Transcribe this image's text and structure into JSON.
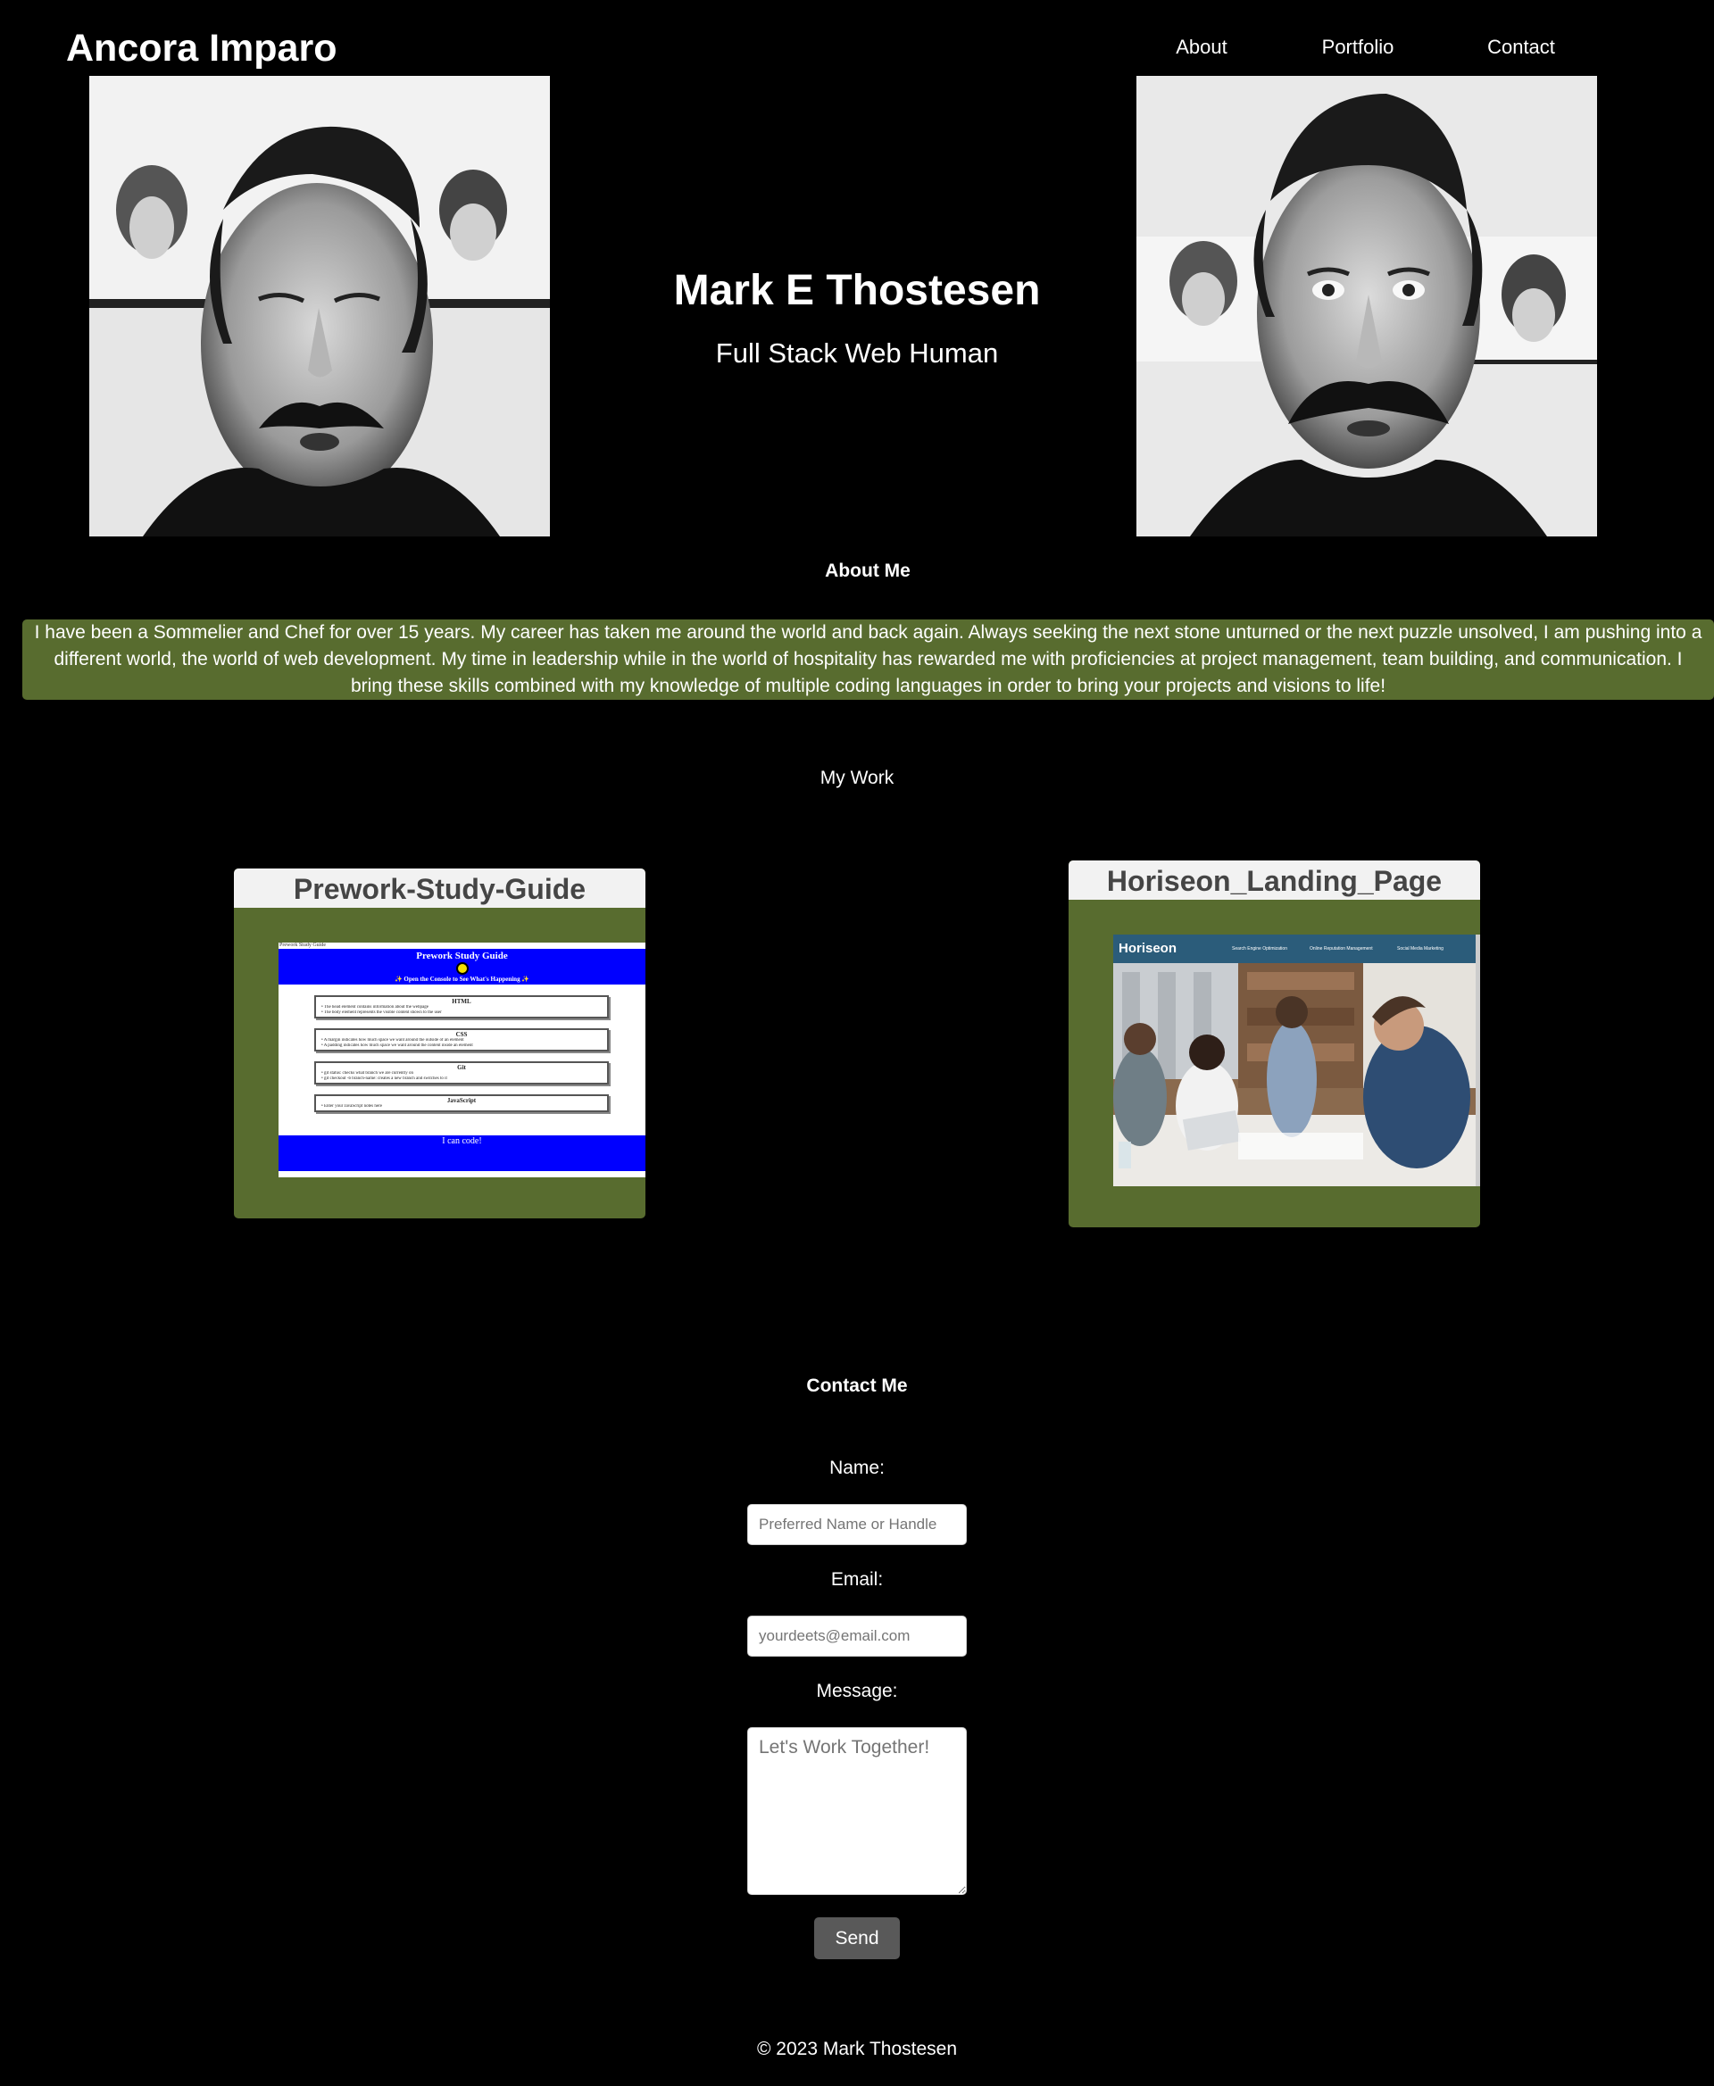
{
  "header": {
    "logo": "Ancora Imparo",
    "nav": [
      "About",
      "Portfolio",
      "Contact"
    ]
  },
  "hero": {
    "name": "Mark E Thostesen",
    "subtitle": "Full Stack Web Human"
  },
  "about": {
    "title": "About Me",
    "text": "I have been a Sommelier and Chef for over 15 years. My career has taken me around the world and back again. Always seeking the next stone unturned or the next puzzle unsolved, I am pushing into a different world, the world of web development. My time in leadership while in the world of hospitality has rewarded me with proficiencies at project management, team building, and communication. I bring these skills combined with my knowledge of multiple coding languages in order to bring your projects and visions to life!"
  },
  "work": {
    "title": "My Work",
    "projects": [
      {
        "title": "Prework-Study-Guide",
        "screenshot": {
          "tab": "Prework Study Guide",
          "heading": "Prework Study Guide",
          "banner": "✨ Open the Console to See What's Happening ✨",
          "sections": [
            {
              "name": "HTML",
              "lines": [
                "The head element contains information about the webpage",
                "The body element represents the visible content shown to the user"
              ]
            },
            {
              "name": "CSS",
              "lines": [
                "A margin indicates how much space we want around the outside of an element",
                "A padding indicates how much space we want around the content inside an element"
              ]
            },
            {
              "name": "Git",
              "lines": [
                "git status: checks what branch we are currently on",
                "git checkout -b branch-name: creates a new branch and switches to it"
              ]
            },
            {
              "name": "JavaScript",
              "lines": [
                "Enter your JavaScript notes here"
              ]
            }
          ],
          "footer": "I can code!"
        }
      },
      {
        "title": "Horiseon_Landing_Page",
        "screenshot": {
          "brand": "Horiseon",
          "nav": [
            "Search Engine Optimization",
            "Online Reputation Management",
            "Social Media Marketing"
          ]
        }
      }
    ]
  },
  "contact": {
    "title": "Contact Me",
    "name_label": "Name:",
    "name_placeholder": "Preferred Name or Handle",
    "email_label": "Email:",
    "email_placeholder": "yourdeets@email.com",
    "message_label": "Message:",
    "message_placeholder": "Let's Work Together!",
    "send_label": "Send"
  },
  "footer": {
    "copyright": "© 2023 Mark Thostesen"
  },
  "colors": {
    "background": "#000000",
    "accent_green": "#586c2f",
    "card_header": "#f2f2f2",
    "button": "#595959",
    "study_guide_blue": "#0000ff",
    "horiseon_blue": "#2b5c7a"
  },
  "images": {
    "portrait_left": "portrait-photo-eyes-closed",
    "portrait_right": "portrait-photo-eyes-open"
  }
}
